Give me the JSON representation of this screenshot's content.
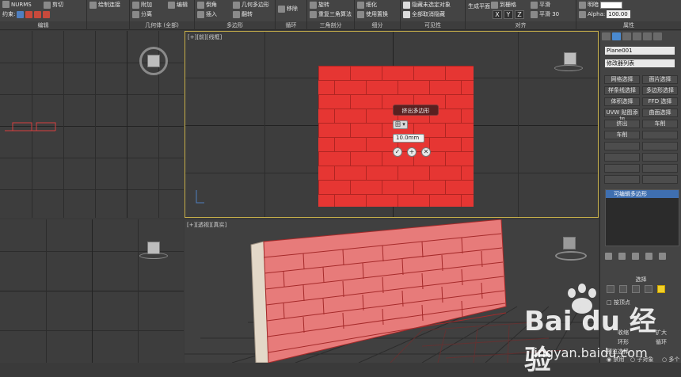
{
  "ribbon": {
    "groups": [
      {
        "label": "编辑"
      },
      {
        "label": "几何体 (全部)"
      },
      {
        "label": "多边形"
      },
      {
        "label": "循环"
      },
      {
        "label": "三角剖分"
      },
      {
        "label": "细分"
      },
      {
        "label": "可见性"
      },
      {
        "label": "对齐"
      },
      {
        "label": "属性"
      }
    ],
    "items": {
      "nurms": "NURMS",
      "cut": "剪切",
      "constraint": "约束:",
      "draw_connect": "绘制连接",
      "attach": "附加",
      "detach": "分离",
      "cap": "编辑",
      "bevel": "倒角",
      "insert": "插入",
      "geo_poly": "几何多边形",
      "flip": "翻转",
      "remove": "移除",
      "spin": "旋转",
      "retriangulate": "重复三角算法",
      "smooth": "细化",
      "use_displace": "使用置换",
      "hide_unselected": "隐藏未选定对象",
      "unhide_all": "全部取消隐藏",
      "make_planar": "生成平面",
      "x": "X",
      "y": "Y",
      "z": "Z",
      "to_grid": "到栅格",
      "smooth_prop": "平滑",
      "smooth_30": "平滑 30",
      "hard": "硬",
      "shade": "明暗",
      "alpha": "Alpha:",
      "alpha_value": "100.00"
    }
  },
  "viewports": {
    "front_label": "[+][前][线框]",
    "persp_label": "[+][透视][真实]",
    "tl_label": "",
    "bl_label": ""
  },
  "caddy": {
    "title": "挤出多边形",
    "type_icon": "田",
    "height_value": "10.0mm",
    "ok": "✓",
    "apply": "+",
    "cancel": "✕"
  },
  "command_panel": {
    "object_name": "Plane001",
    "modifier_list": "修改器列表",
    "buttons": [
      "网格选择",
      "面片选择",
      "样条线选择",
      "多边形选择",
      "体积选择",
      "FFD 选择",
      "UVW 贴图添加",
      "曲面选择",
      "挤出",
      "车削",
      "车削",
      ""
    ],
    "stack_item": "可编辑多边形",
    "selection_title": "选择",
    "by_vertex": "按顶点",
    "shrink": "收缩",
    "grow": "扩大",
    "ring": "环形",
    "loop": "循环",
    "preview_sel": "预览选择",
    "disabled": "禁用",
    "sub_object": "子对象",
    "multi": "多个"
  },
  "watermark": {
    "logo": "Bai du 经验",
    "url": "jingyan.baidu.com"
  },
  "colors": {
    "brick": "#e63633",
    "mortar": "#b02522",
    "selection": "#f1d02a",
    "active_border": "#c8b04a"
  }
}
